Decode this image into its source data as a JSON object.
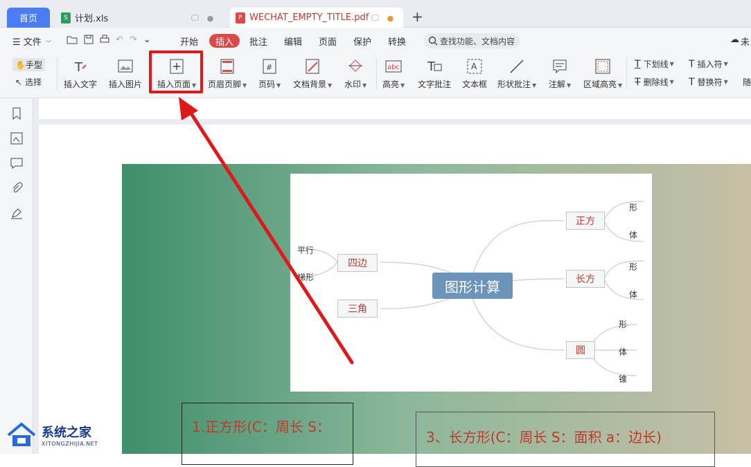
{
  "tabs": {
    "home": "首页",
    "xls": "计划.xls",
    "pdf": "WECHAT_EMPTY_TITLE.pdf"
  },
  "menu": {
    "file": "文件",
    "items": [
      "开始",
      "插入",
      "批注",
      "编辑",
      "页面",
      "保护",
      "转换"
    ],
    "search_placeholder": "查找功能、文档内容",
    "right_cut": "未"
  },
  "toolbar": {
    "hand": "手型",
    "select": "选择",
    "insert_text": "插入文字",
    "insert_image": "插入图片",
    "insert_page": "插入页面",
    "header_footer": "页眉页脚",
    "page_number": "页码",
    "doc_background": "文档背景",
    "watermark": "水印",
    "highlight": "高亮",
    "text_comment": "文字批注",
    "text_box": "文本框",
    "shape_comment": "形状批注",
    "annotation": "注解",
    "area_highlight": "区域高亮",
    "underline": "下划线",
    "strikethrough": "删除线",
    "insert_char": "插入符",
    "replace_char": "替换符",
    "right_cut": "随"
  },
  "mindmap": {
    "center": "图形计算",
    "nodes": {
      "square": "正方",
      "rect": "长方",
      "circle": "圆",
      "quad": "四边",
      "triangle": "三角"
    },
    "leaves": {
      "sq1": "形",
      "sq2": "体",
      "rc1": "形",
      "rc2": "体",
      "ci1": "形",
      "ci2": "体",
      "ci3": "锥",
      "quad1": "平行",
      "quad2": "梯形"
    }
  },
  "content": {
    "box1": "1.正方形(C：周长  S：",
    "box2": "3、长方形(C：周长    S：面积      a：边长)"
  },
  "watermark": {
    "main": "系统之家",
    "sub": "XITONGZHIJIA.NET"
  },
  "colors": {
    "accent": "#d94a4a",
    "home_tab": "#4a7cf2",
    "highlight_box": "#e0181b",
    "arrow": "#e0181b"
  }
}
